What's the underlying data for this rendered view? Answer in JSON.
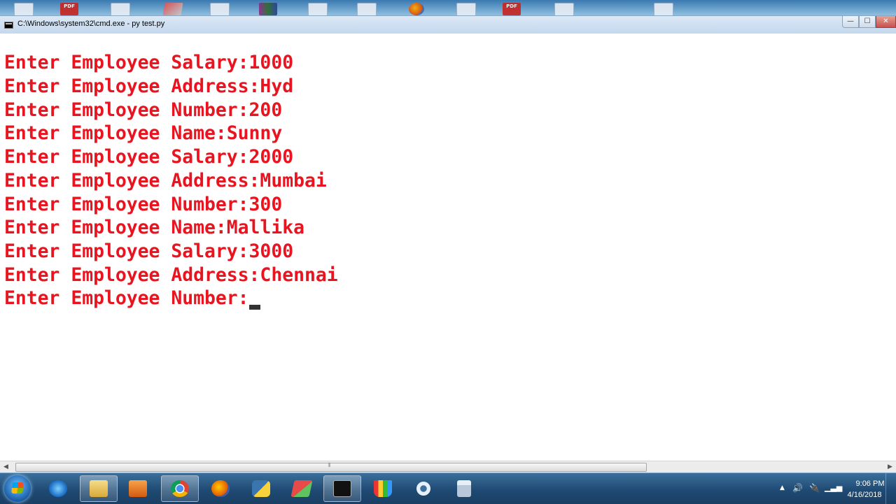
{
  "window": {
    "title": "C:\\Windows\\system32\\cmd.exe - py  test.py",
    "minimize": "—",
    "maximize": "☐",
    "close": "✕"
  },
  "console": {
    "lines": [
      "Enter Employee Salary:1000",
      "Enter Employee Address:Hyd",
      "Enter Employee Number:200",
      "Enter Employee Name:Sunny",
      "Enter Employee Salary:2000",
      "Enter Employee Address:Mumbai",
      "Enter Employee Number:300",
      "Enter Employee Name:Mallika",
      "Enter Employee Salary:3000",
      "Enter Employee Address:Chennai",
      "Enter Employee Number:"
    ],
    "text_color": "#e8141f",
    "background": "#ffffff"
  },
  "desktop_icons": [
    {
      "icon": "pdf-file-icon",
      "label": "PDF"
    },
    {
      "icon": "pdf-file-icon",
      "label": "PDF"
    }
  ],
  "taskbar": {
    "apps": [
      {
        "name": "internet-explorer-icon"
      },
      {
        "name": "file-explorer-icon"
      },
      {
        "name": "media-player-icon"
      },
      {
        "name": "chrome-icon"
      },
      {
        "name": "firefox-icon"
      },
      {
        "name": "python-icon"
      },
      {
        "name": "eraser-app-icon"
      },
      {
        "name": "cmd-icon",
        "active": true
      },
      {
        "name": "paint-icon"
      },
      {
        "name": "settings-gear-icon"
      },
      {
        "name": "calculator-icon"
      }
    ],
    "clock": {
      "time": "9:06 PM",
      "date": "4/16/2018"
    }
  }
}
